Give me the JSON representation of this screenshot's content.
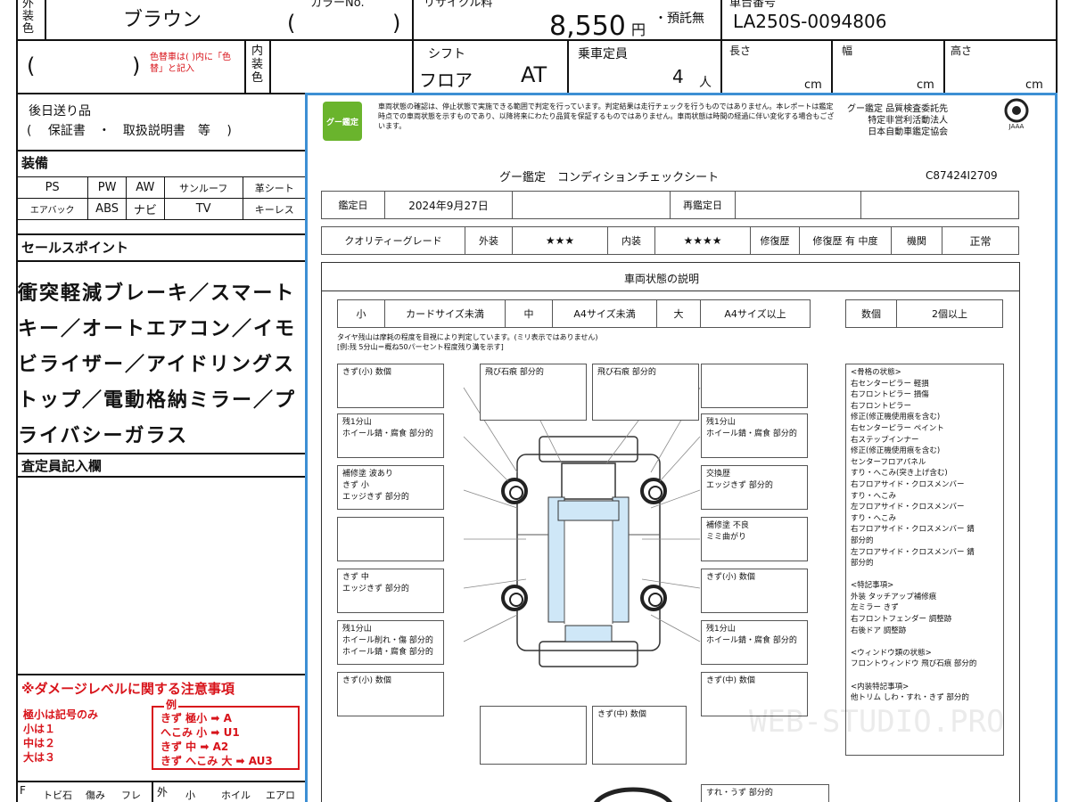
{
  "header": {
    "exterior_label": "外装色",
    "exterior_color": "ブラウン",
    "color_no_label": "カラーNo.",
    "color_no_open": "(",
    "color_no_close": ")",
    "recycle_label": "リサイクル料",
    "recycle_amount": "8,550",
    "recycle_unit": "円",
    "deposit_status": "・預託無",
    "chassis_label": "車台番号",
    "chassis_no": "LA250S-0094806",
    "note_open": "(",
    "note_close": ")",
    "note_red": "色替車は( )内に「色替」と記入",
    "interior_label": "内装色",
    "shift_label": "シフト",
    "shift_type": "フロア",
    "shift_trans": "AT",
    "capacity_label": "乗車定員",
    "capacity_value": "4",
    "capacity_unit": "人",
    "length_label": "長さ",
    "width_label": "幅",
    "height_label": "高さ",
    "dim_unit": "cm"
  },
  "left": {
    "later_label": "後日送り品",
    "later_items": "(　 保証書　・　取扱説明書　等　 )",
    "equipment_label": "装備",
    "equipment": [
      [
        "PS",
        "PW",
        "AW",
        "サンルーフ",
        "革シート"
      ],
      [
        "エアバック",
        "ABS",
        "ナビ",
        "TV",
        "キーレス"
      ]
    ],
    "sales_label": "セールスポイント",
    "sales_lines": [
      "衝突軽減ブレーキ／スマート",
      "キー／オートエアコン／イモ",
      "ビライザー／アイドリングス",
      "トップ／電動格納ミラー／プ",
      "ライバシーガラス"
    ],
    "appraiser_label": "査定員記入欄",
    "damage_title": "※ダメージレベルに関する注意事項",
    "damage_notes": [
      "極小は記号のみ",
      "小は１",
      "中は２",
      "大は３"
    ],
    "example_label": "例",
    "example_lines": [
      "きず 極小 ➡ A",
      "へこみ 小 ➡ U1",
      "きず 中 ➡ A2",
      "きず へこみ 大 ➡ AU3"
    ],
    "bottom_cells": [
      "F",
      "トビ石",
      "傷み",
      "フレ",
      "外",
      "小",
      "ホイル",
      "エアロ"
    ]
  },
  "sheet": {
    "logo_text": "グー鑑定",
    "disclaimer": [
      "車両状態の確認は、停止状態で実施できる範囲で判定を行っています。判定結果は走行チェックを行うものではありません。本レポートは鑑定時点での車両状態を示すものであり、以降将来にわたり品質を保証するものではありません。車両状態は時間の経過に伴い変化する場合もございます。"
    ],
    "org_lines": [
      "グー鑑定 品質検査委託先",
      "特定非営利活動法人",
      "日本自動車鑑定協会"
    ],
    "org_logo_text": "JAAA",
    "title": "グー鑑定　コンディションチェックシート",
    "sheet_id": "C87424I2709",
    "appraisal_date_label": "鑑定日",
    "appraisal_date": "2024年9月27日",
    "reappraisal_label": "再鑑定日",
    "grade_label": "クオリティーグレード",
    "exterior_label": "外装",
    "exterior_stars": "★★★",
    "interior_label": "内装",
    "interior_stars": "★★★★",
    "repair_label": "修復歴",
    "repair_value": "修復歴 有 中度",
    "engine_label": "機関",
    "engine_value": "正常",
    "condition_title": "車両状態の説明",
    "size_small_label": "小",
    "size_small": "カードサイズ未満",
    "size_mid_label": "中",
    "size_mid": "A4サイズ未満",
    "size_large_label": "大",
    "size_large": "A4サイズ以上",
    "count_label": "数個",
    "count_value": "2個以上",
    "tire_note_1": "タイヤ残山は摩耗の程度を目視により判定しています。(ミリ表示ではありません)",
    "tire_note_2": "[例:残 5分山＝概ね50パーセント程度残り溝を示す]",
    "cards_left": [
      "きず(小) 数個",
      "残1分山\nホイール錆・腐食 部分的",
      "補修塗 波あり\nきず 小\nエッジきず 部分的",
      "",
      "きず 中\nエッジきず 部分的",
      "残1分山\nホイール削れ・傷 部分的\nホイール錆・腐食 部分的",
      "きず(小) 数個"
    ],
    "cards_right": [
      "",
      "残1分山\nホイール錆・腐食 部分的",
      "交換歴\nエッジきず 部分的",
      "補修塗 不良\nミミ曲がり",
      "きず(小) 数個",
      "残1分山\nホイール錆・腐食 部分的",
      "きず(中) 数個"
    ],
    "cards_top": [
      "飛び石痕 部分的",
      "飛び石痕 部分的"
    ],
    "card_bottom_center": "きず(中) 数個",
    "card_bottom_right": "すれ・うず 部分的",
    "frame_notes": "<骨格の状態>\n右センターピラー 軽損\n右フロントピラー 損傷\n右フロントピラー\n修正(修正機使用痕を含む)\n右センターピラー ペイント\n右ステップインナー\n修正(修正機使用痕を含む)\nセンターフロアパネル\nすり・へこみ(突き上げ含む)\n右フロアサイド・クロスメンバー\nすり・へこみ\n左フロアサイド・クロスメンバー\nすり・へこみ\n右フロアサイド・クロスメンバー 錆\n部分的\n左フロアサイド・クロスメンバー 錆\n部分的\n\n<特記事項>\n外装 タッチアップ補修痕\n左ミラー きず\n右フロントフェンダー 調整跡\n右後ドア 調整跡\n\n<ウィンドウ類の状態>\nフロントウィンドウ 飛び石痕 部分的\n\n<内装特記事項>\n他トリム しわ・すれ・きず 部分的"
  },
  "watermark": "WEB-STUDIO.PRO",
  "colors": {
    "accent_blue": "#3d8fd4",
    "red": "#d8141b",
    "logo_green": "#6ab42d"
  }
}
